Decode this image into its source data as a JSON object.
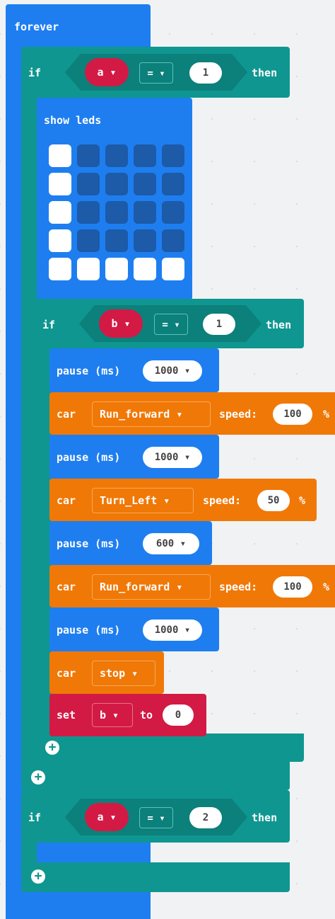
{
  "forever_label": "forever",
  "if1": {
    "label": "if",
    "var": "a ▾",
    "op": "= ▾",
    "value": "1",
    "then": "then"
  },
  "show_leds_label": "show leds",
  "leds": [
    [
      1,
      0,
      0,
      0,
      0
    ],
    [
      1,
      0,
      0,
      0,
      0
    ],
    [
      1,
      0,
      0,
      0,
      0
    ],
    [
      1,
      0,
      0,
      0,
      0
    ],
    [
      1,
      1,
      1,
      1,
      1
    ]
  ],
  "if2": {
    "label": "if",
    "var": "b ▾",
    "op": "= ▾",
    "value": "1",
    "then": "then"
  },
  "pause_label": "pause (ms)",
  "car_label": "car",
  "speed_label": "speed:",
  "percent": "%",
  "pause1": "1000 ▾",
  "car1": {
    "action": "Run_forward ▾",
    "speed": "100"
  },
  "pause2": "1000 ▾",
  "car2": {
    "action": "Turn_Left ▾",
    "speed": "50"
  },
  "pause3": "600 ▾",
  "car3": {
    "action": "Run_forward ▾",
    "speed": "100"
  },
  "pause4": "1000 ▾",
  "car4": {
    "action": "stop ▾"
  },
  "set": {
    "label": "set",
    "var": "b ▾",
    "to": "to",
    "value": "0"
  },
  "if3": {
    "label": "if",
    "var": "a ▾",
    "op": "= ▾",
    "value": "2",
    "then": "then"
  },
  "plus_symbol": "+"
}
